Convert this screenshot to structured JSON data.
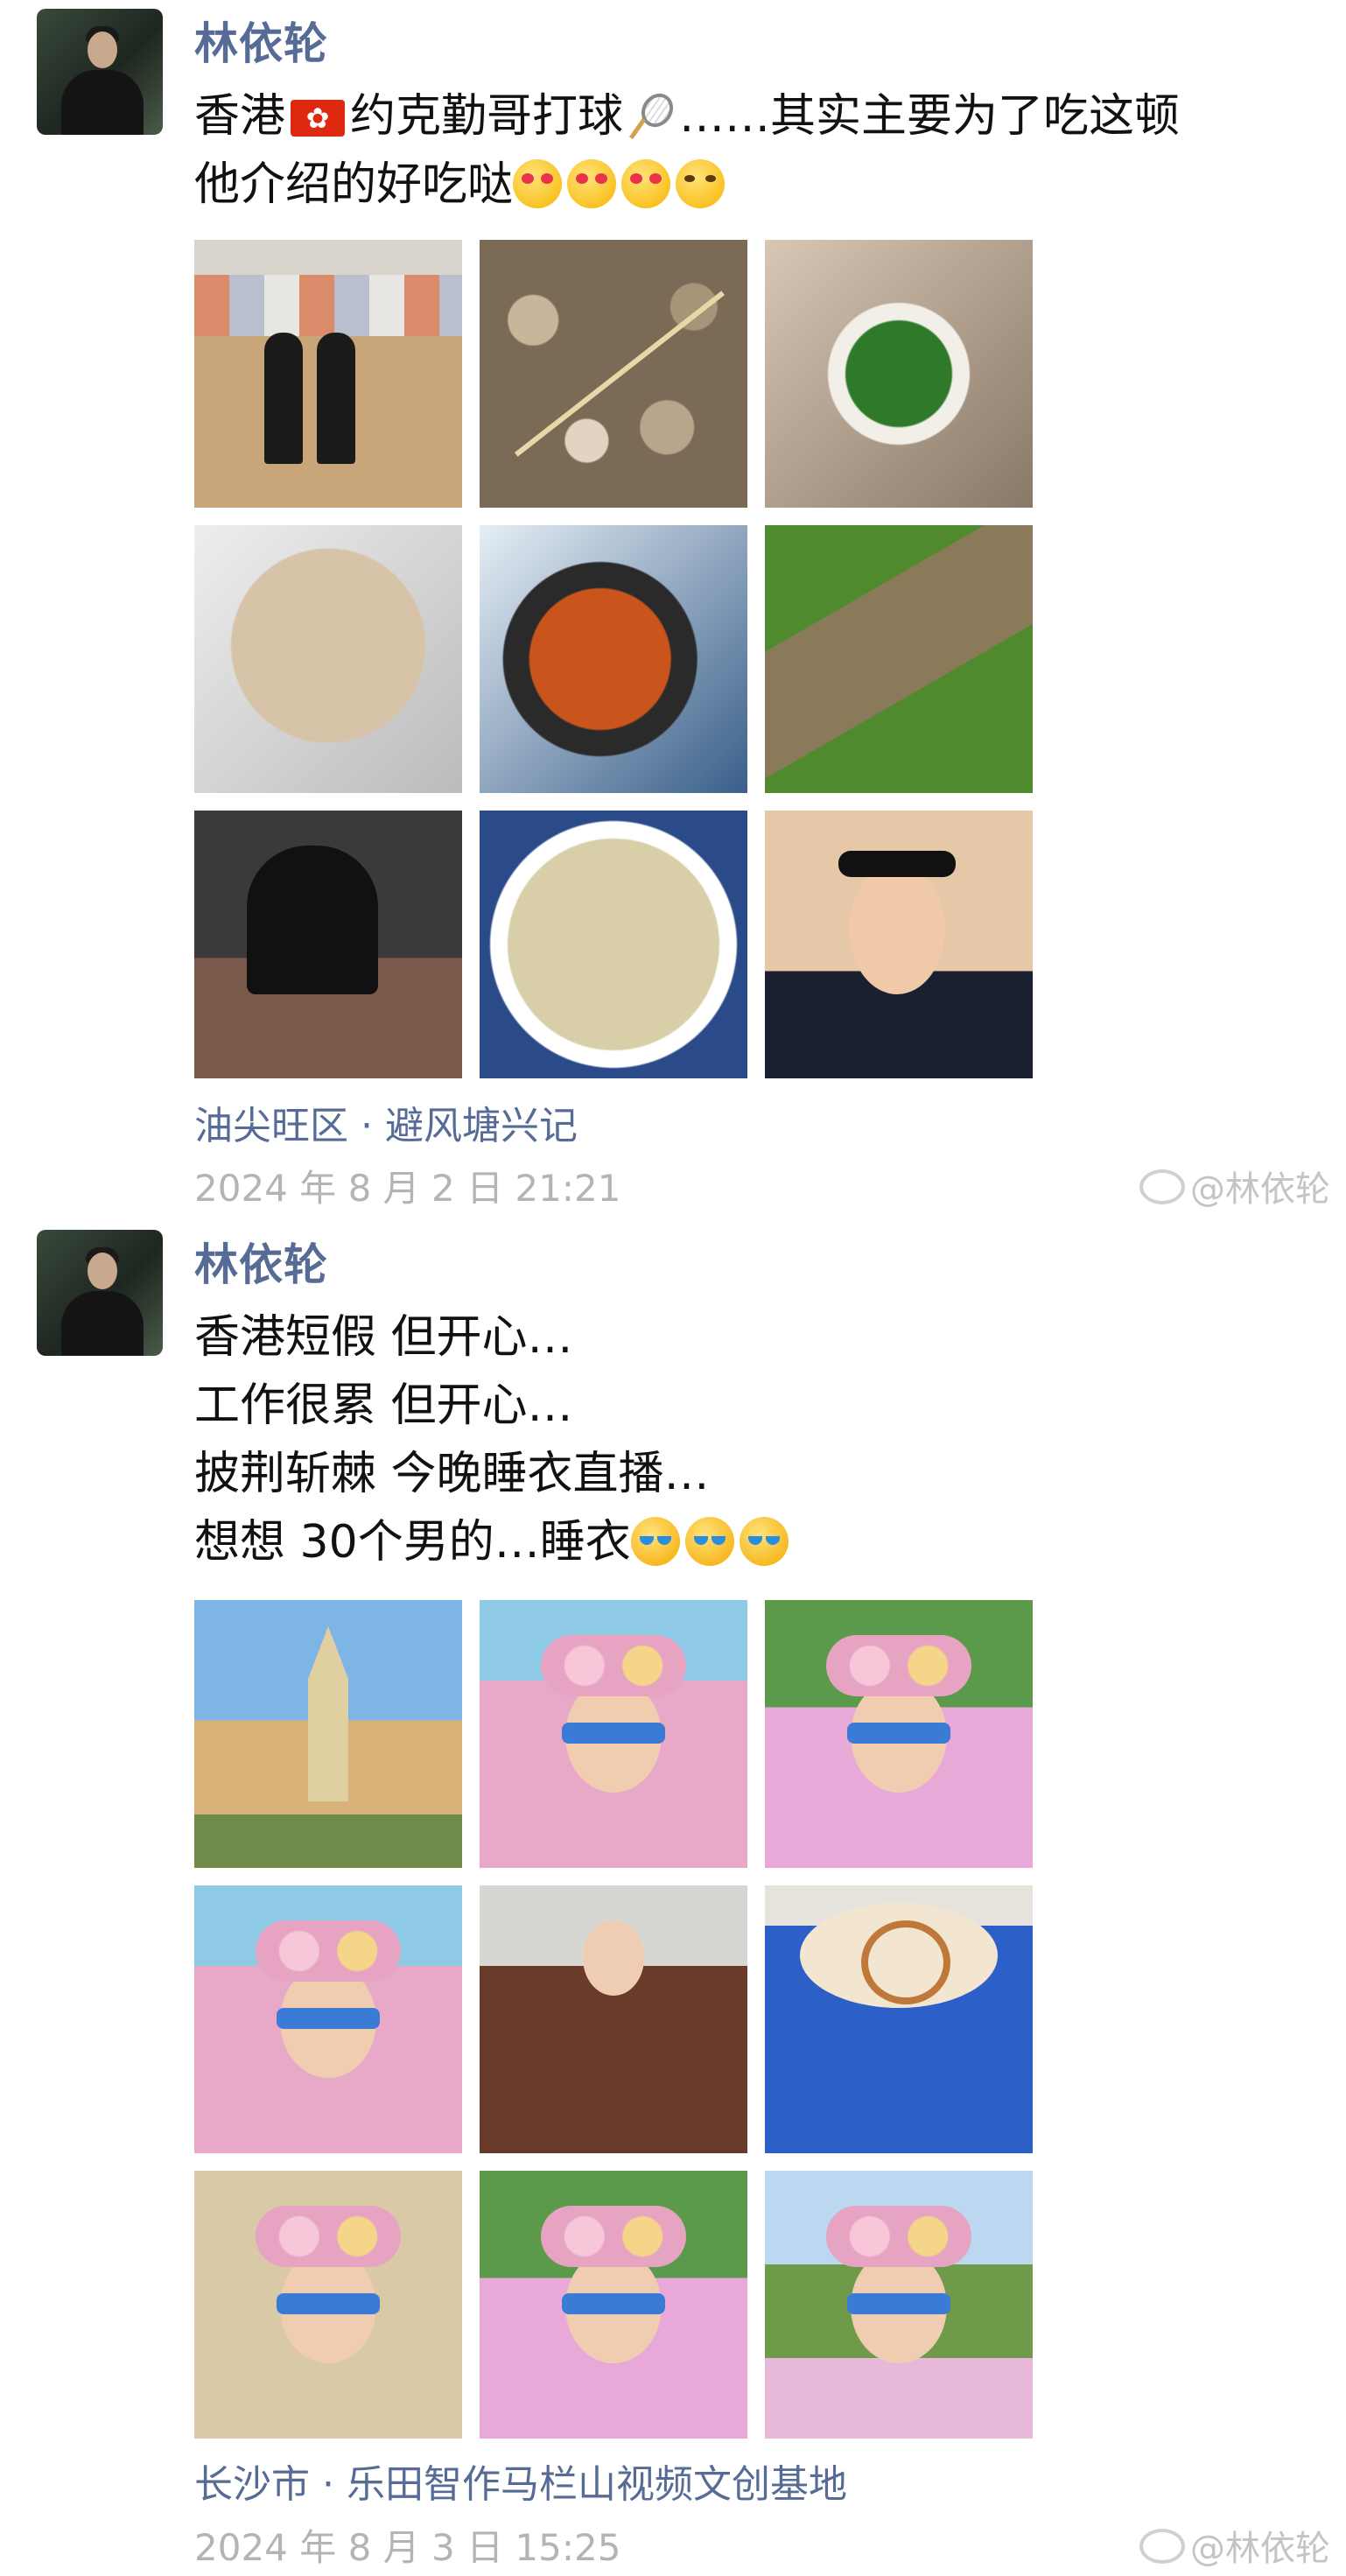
{
  "posts": [
    {
      "author": "林依轮",
      "text_lines": [
        "香港",
        "约克勤哥打球",
        "……其实主要为了吃这顿",
        "他介绍的好吃哒"
      ],
      "location": "油尖旺区 · 避风塘兴记",
      "time": "2024 年 8 月 2 日 21:21",
      "watermark": "@林依轮",
      "images": [
        "badminton-court-photo",
        "snails-photo",
        "platter-photo",
        "tofu-skin-photo",
        "crab-photo",
        "clams-photo",
        "dinner-party-photo",
        "steamed-fish-photo",
        "selfie-headband-photo"
      ],
      "icons": [
        "hk-flag-icon",
        "badminton-racket-icon",
        "heart-eyes-emoji",
        "grin-emoji"
      ]
    },
    {
      "author": "林依轮",
      "text_lines": [
        "香港短假 但开心…",
        "工作很累 但开心…",
        "披荆斩棘 今晚睡衣直播…",
        "想想 30个男的…睡衣"
      ],
      "location": "长沙市 · 乐田智作马栏山视频文创基地",
      "time": "2024 年 8 月 3 日 15:25",
      "watermark": "@林依轮",
      "images": [
        "castle-photo",
        "pink-outfit-photo",
        "plush-hat-selfie-photo",
        "plush-hat-photo-2",
        "robe-photo",
        "mickey-latte-photo",
        "plush-hat-photo-3",
        "pink-chair-photo",
        "garden-photo"
      ],
      "icons": [
        "laugh-cry-emoji"
      ]
    }
  ],
  "colors": {
    "name": "#566b95",
    "time": "#b4b4b4",
    "text": "#111111"
  }
}
